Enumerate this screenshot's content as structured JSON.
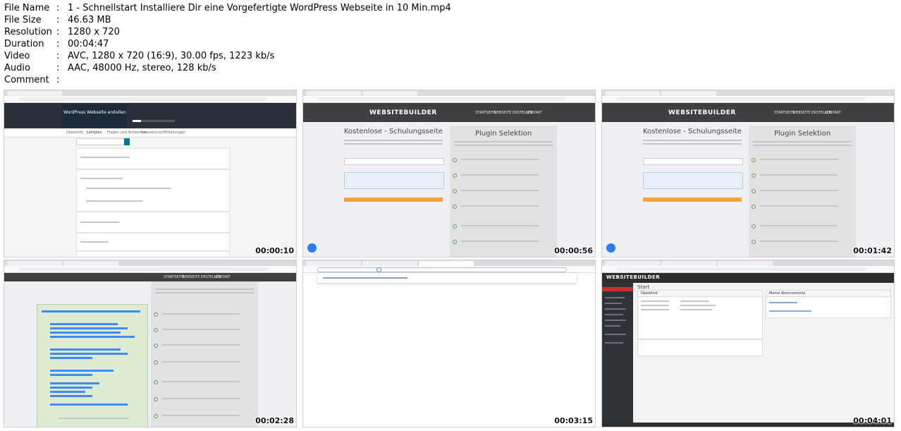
{
  "file_info": {
    "rows": [
      {
        "key": "File Name",
        "value": "1 - Schnellstart Installiere Dir eine Vorgefertigte WordPress Webseite in 10 Min.mp4"
      },
      {
        "key": "File Size",
        "value": "46.63 MB"
      },
      {
        "key": "Resolution",
        "value": "1280 x 720"
      },
      {
        "key": "Duration",
        "value": "00:04:47"
      },
      {
        "key": "Video",
        "value": "AVC, 1280 x 720 (16:9), 30.00 fps, 1223 kb/s"
      },
      {
        "key": "Audio",
        "value": "AAC, 48000 Hz, stereo, 128 kb/s"
      },
      {
        "key": "Comment",
        "value": ""
      }
    ],
    "separator": ":"
  },
  "thumbnails": [
    {
      "timestamp": "00:00:10",
      "screen": "course-page"
    },
    {
      "timestamp": "00:00:56",
      "screen": "plugin-page"
    },
    {
      "timestamp": "00:01:42",
      "screen": "plugin-page"
    },
    {
      "timestamp": "00:02:28",
      "screen": "plugin-page-selected"
    },
    {
      "timestamp": "00:03:15",
      "screen": "browser-new-tab"
    },
    {
      "timestamp": "00:04:01",
      "screen": "dashboard"
    }
  ],
  "site": {
    "logo": "WEBSITEBUILDER",
    "nav": [
      "STARTSEITE",
      "WEBSEITE ERSTELLEN",
      "KONTAKT"
    ],
    "left_heading": "Kostenlose - Schulungsseite",
    "right_heading": "Plugin Selektion"
  },
  "course": {
    "banner_title": "WordPress Webseite erstellen",
    "tabs": [
      "Übersicht",
      "Lehrplan",
      "Fragen und Antworten",
      "Lesezeichen",
      "Mitteilungen"
    ]
  },
  "dashboard": {
    "title": "Start",
    "panel_left": "Überblick",
    "panel_right": "Meine Abonnements"
  },
  "colors": {
    "nav_dark": "#3f3f41",
    "accent_orange": "#f0a640",
    "check_green": "#5aa05a",
    "chat_blue": "#2b7de9",
    "selection_blue": "#3d8bff",
    "dashboard_red": "#c9302c"
  }
}
